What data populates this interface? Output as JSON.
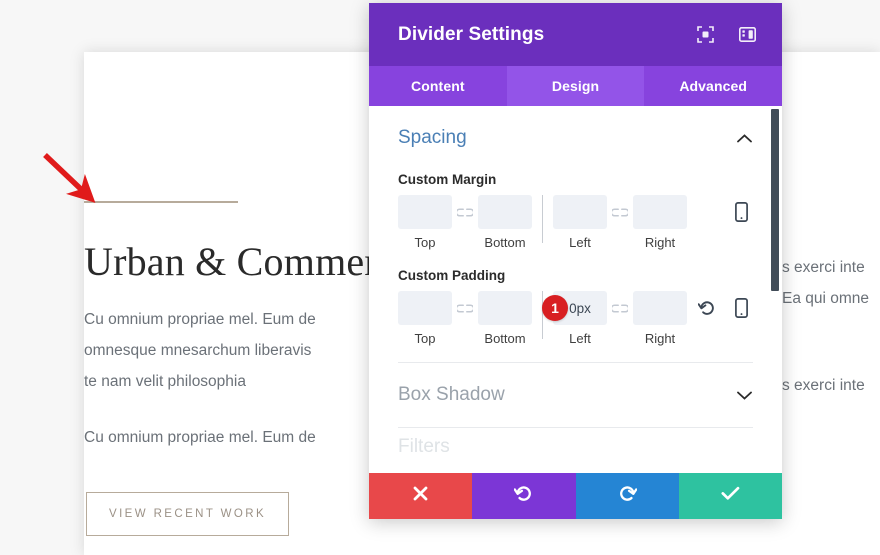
{
  "website": {
    "divider_color": "#b7ab9b",
    "heading": "Urban & Commer",
    "paragraph_1_lines": [
      "Cu omnium propriae mel. Eum de",
      "omnesque mnesarchum liberavis",
      "te nam velit philosophia"
    ],
    "paragraph_2_lines": [
      "Cu omnium propriae mel. Eum de"
    ],
    "right_clipped_lines": [
      "s exerci inte",
      "Ea qui omne",
      "s exerci inte"
    ],
    "cta_label": "VIEW RECENT WORK"
  },
  "annotation": {
    "arrow_color": "#e01b1b",
    "badge_number": "1",
    "badge_color": "#d81f22"
  },
  "modal": {
    "title": "Divider Settings",
    "accent_header": "#6b2fbd",
    "accent_tabs": "#8743de",
    "header_icons": [
      {
        "name": "focus-module-icon"
      },
      {
        "name": "toggle-panel-icon"
      }
    ],
    "tabs": [
      {
        "label": "Content",
        "active": false
      },
      {
        "label": "Design",
        "active": true
      },
      {
        "label": "Advanced",
        "active": false
      }
    ],
    "sections": [
      {
        "title": "Spacing",
        "expanded": true,
        "title_color": "#4a7fb5",
        "fields": [
          {
            "label": "Custom Margin",
            "inputs": [
              {
                "caption": "Top",
                "value": "",
                "placeholder": ""
              },
              {
                "caption": "Bottom",
                "value": "",
                "placeholder": ""
              },
              {
                "caption": "Left",
                "value": "",
                "placeholder": ""
              },
              {
                "caption": "Right",
                "value": "",
                "placeholder": ""
              }
            ],
            "tools": [
              "mobile-icon"
            ],
            "has_reset": false
          },
          {
            "label": "Custom Padding",
            "inputs": [
              {
                "caption": "Top",
                "value": "",
                "placeholder": ""
              },
              {
                "caption": "Bottom",
                "value": "",
                "placeholder": ""
              },
              {
                "caption": "Left",
                "value": "0px",
                "placeholder": ""
              },
              {
                "caption": "Right",
                "value": "",
                "placeholder": ""
              }
            ],
            "tools": [
              "reset-icon",
              "mobile-icon"
            ],
            "has_reset": true
          }
        ]
      },
      {
        "title": "Box Shadow",
        "expanded": false,
        "title_color": "#9aa2ab"
      },
      {
        "title": "Filters",
        "expanded": false,
        "title_color": "#dfe3e6"
      }
    ],
    "footer_buttons": [
      {
        "name": "cancel-button",
        "icon": "close-icon",
        "color": "#e8484a"
      },
      {
        "name": "undo-button",
        "icon": "undo-icon",
        "color": "#7c36d6"
      },
      {
        "name": "redo-button",
        "icon": "redo-icon",
        "color": "#2585d4"
      },
      {
        "name": "save-button",
        "icon": "check-icon",
        "color": "#2ec2a0"
      }
    ]
  }
}
